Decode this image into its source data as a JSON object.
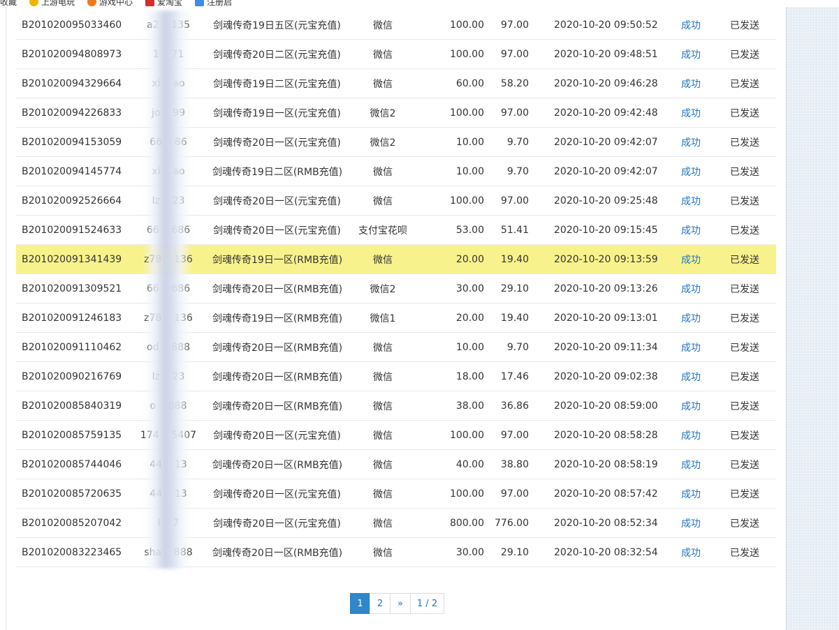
{
  "bookmarks": [
    {
      "label": "收藏",
      "icon": "bookmark-star-icon"
    },
    {
      "label": "上游电玩",
      "icon": "yellow-circle-icon"
    },
    {
      "label": "游戏中心",
      "icon": "orange-arrow-icon"
    },
    {
      "label": "爱淘宝",
      "icon": "red-square-icon"
    },
    {
      "label": "注册启",
      "icon": "blue-square-icon"
    }
  ],
  "orders": [
    {
      "id": "B201020095033460",
      "user": "a2    135",
      "server": "剑魂传奇19日五区(元宝充值)",
      "pay": "微信",
      "amount": "100.00",
      "actual": "97.00",
      "time": "2020-10-20 09:50:52",
      "status": "成功",
      "sent": "已发送"
    },
    {
      "id": "B201020094808973",
      "user": "1    71",
      "server": "剑魂传奇20日二区(元宝充值)",
      "pay": "微信",
      "amount": "100.00",
      "actual": "97.00",
      "time": "2020-10-20 09:48:51",
      "status": "成功",
      "sent": "已发送"
    },
    {
      "id": "B201020094329664",
      "user": "xi    ao",
      "server": "剑魂传奇19日二区(元宝充值)",
      "pay": "微信",
      "amount": "60.00",
      "actual": "58.20",
      "time": "2020-10-20 09:46:28",
      "status": "成功",
      "sent": "已发送"
    },
    {
      "id": "B201020094226833",
      "user": "jo    99",
      "server": "剑魂传奇19日一区(元宝充值)",
      "pay": "微信2",
      "amount": "100.00",
      "actual": "97.00",
      "time": "2020-10-20 09:42:48",
      "status": "成功",
      "sent": "已发送"
    },
    {
      "id": "B201020094153059",
      "user": "66    86",
      "server": "剑魂传奇20日一区(元宝充值)",
      "pay": "微信2",
      "amount": "10.00",
      "actual": "9.70",
      "time": "2020-10-20 09:42:07",
      "status": "成功",
      "sent": "已发送"
    },
    {
      "id": "B201020094145774",
      "user": "xi    ao",
      "server": "剑魂传奇19日二区(RMB充值)",
      "pay": "微信",
      "amount": "10.00",
      "actual": "9.70",
      "time": "2020-10-20 09:42:07",
      "status": "成功",
      "sent": "已发送"
    },
    {
      "id": "B201020092526664",
      "user": "lz    23",
      "server": "剑魂传奇20日一区(元宝充值)",
      "pay": "微信",
      "amount": "100.00",
      "actual": "97.00",
      "time": "2020-10-20 09:25:48",
      "status": "成功",
      "sent": "已发送"
    },
    {
      "id": "B201020091524633",
      "user": "66    686",
      "server": "剑魂传奇20日一区(元宝充值)",
      "pay": "支付宝花呗",
      "amount": "53.00",
      "actual": "51.41",
      "time": "2020-10-20 09:15:45",
      "status": "成功",
      "sent": "已发送"
    },
    {
      "id": "B201020091341439",
      "user": "z78    136",
      "server": "剑魂传奇19日一区(RMB充值)",
      "pay": "微信",
      "amount": "20.00",
      "actual": "19.40",
      "time": "2020-10-20 09:13:59",
      "status": "成功",
      "sent": "已发送",
      "highlight": true
    },
    {
      "id": "B201020091309521",
      "user": "66    686",
      "server": "剑魂传奇20日一区(RMB充值)",
      "pay": "微信2",
      "amount": "30.00",
      "actual": "29.10",
      "time": "2020-10-20 09:13:26",
      "status": "成功",
      "sent": "已发送"
    },
    {
      "id": "B201020091246183",
      "user": "z78    136",
      "server": "剑魂传奇19日一区(RMB充值)",
      "pay": "微信1",
      "amount": "20.00",
      "actual": "19.40",
      "time": "2020-10-20 09:13:01",
      "status": "成功",
      "sent": "已发送"
    },
    {
      "id": "B201020091110462",
      "user": "od    888",
      "server": "剑魂传奇20日一区(RMB充值)",
      "pay": "微信",
      "amount": "10.00",
      "actual": "9.70",
      "time": "2020-10-20 09:11:34",
      "status": "成功",
      "sent": "已发送"
    },
    {
      "id": "B201020090216769",
      "user": "lz    23",
      "server": "剑魂传奇20日一区(RMB充值)",
      "pay": "微信",
      "amount": "18.00",
      "actual": "17.46",
      "time": "2020-10-20 09:02:38",
      "status": "成功",
      "sent": "已发送"
    },
    {
      "id": "B201020085840319",
      "user": "o    888",
      "server": "剑魂传奇20日一区(RMB充值)",
      "pay": "微信",
      "amount": "38.00",
      "actual": "36.86",
      "time": "2020-10-20 08:59:00",
      "status": "成功",
      "sent": "已发送"
    },
    {
      "id": "B201020085759135",
      "user": "174    5407",
      "server": "剑魂传奇20日一区(元宝充值)",
      "pay": "微信",
      "amount": "100.00",
      "actual": "97.00",
      "time": "2020-10-20 08:58:28",
      "status": "成功",
      "sent": "已发送"
    },
    {
      "id": "B201020085744046",
      "user": "44    13",
      "server": "剑魂传奇20日一区(RMB充值)",
      "pay": "微信",
      "amount": "40.00",
      "actual": "38.80",
      "time": "2020-10-20 08:58:19",
      "status": "成功",
      "sent": "已发送"
    },
    {
      "id": "B201020085720635",
      "user": "44    13",
      "server": "剑魂传奇20日一区(元宝充值)",
      "pay": "微信",
      "amount": "100.00",
      "actual": "97.00",
      "time": "2020-10-20 08:57:42",
      "status": "成功",
      "sent": "已发送"
    },
    {
      "id": "B201020085207042",
      "user": "l    7",
      "server": "剑魂传奇20日一区(元宝充值)",
      "pay": "微信",
      "amount": "800.00",
      "actual": "776.00",
      "time": "2020-10-20 08:52:34",
      "status": "成功",
      "sent": "已发送"
    },
    {
      "id": "B201020083223465",
      "user": "sha    888",
      "server": "剑魂传奇20日一区(RMB充值)",
      "pay": "微信",
      "amount": "30.00",
      "actual": "29.10",
      "time": "2020-10-20 08:32:54",
      "status": "成功",
      "sent": "已发送"
    }
  ],
  "pagination": {
    "page1": "1",
    "page2": "2",
    "next": "»",
    "info": "1 / 2"
  },
  "colors": {
    "status_link": "#1f74c6",
    "highlight_row": "#f8f28c",
    "active_page": "#2f86c8",
    "side_panel": "#e4ecf5"
  }
}
